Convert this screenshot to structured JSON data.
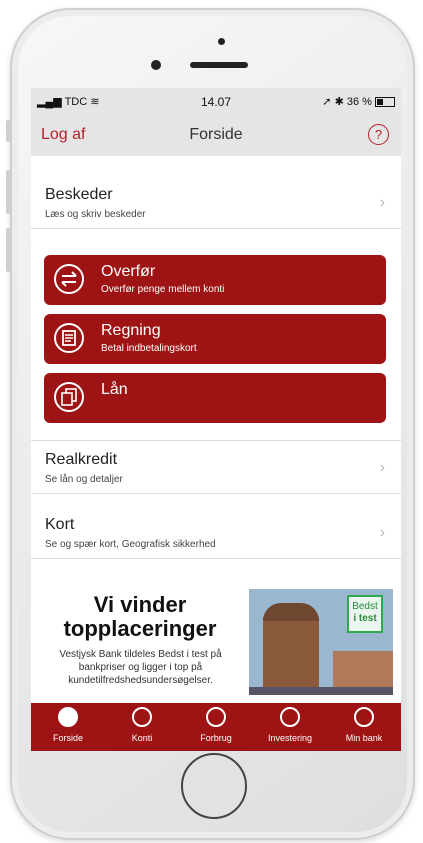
{
  "statusbar": {
    "carrier": "TDC",
    "time": "14.07",
    "battery": "36 %"
  },
  "nav": {
    "left": "Log af",
    "title": "Forside",
    "help": "?"
  },
  "rows": {
    "beskeder": {
      "title": "Beskeder",
      "sub": "Læs og skriv beskeder"
    },
    "realkredit": {
      "title": "Realkredit",
      "sub": "Se lån og detaljer"
    },
    "kort": {
      "title": "Kort",
      "sub": "Se og spær kort, Geografisk sikkerhed"
    }
  },
  "buttons": [
    {
      "label": "Overfør",
      "sub": "Overfør penge mellem konti"
    },
    {
      "label": "Regning",
      "sub": "Betal indbetalingskort"
    },
    {
      "label": "Lån",
      "sub": ""
    }
  ],
  "promo": {
    "title1": "Vi vinder",
    "title2": "topplaceringer",
    "text": "Vestjysk Bank tildeles Bedst i test på bankpriser og ligger i top på kundetilfredshedsundersøgelser.",
    "badge_line1": "Bedst",
    "badge_line2": "i test"
  },
  "tabs": [
    "Forside",
    "Konti",
    "Forbrug",
    "Investering",
    "Min bank"
  ],
  "colors": {
    "brand_red": "#9e1313",
    "accent_red": "#b4202a"
  }
}
